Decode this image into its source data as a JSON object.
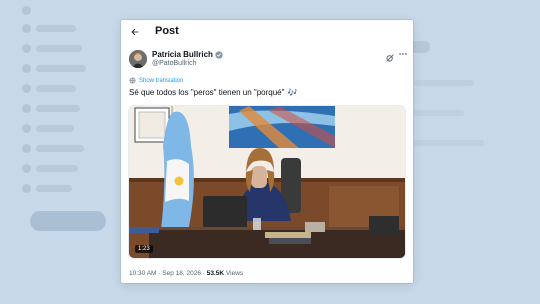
{
  "header": {
    "title": "Post"
  },
  "author": {
    "name": "Patricia Bullrich",
    "handle": "@PatoBullrich"
  },
  "translate": {
    "label": "Show translation"
  },
  "tweet": {
    "text": "Sé que todos los \"peros\" tienen un \"porqué\"",
    "emoji": "🎶"
  },
  "media": {
    "duration": "1:23"
  },
  "meta": {
    "time": "10:30 AM",
    "sep": "·",
    "date": "Sep 18, 2026",
    "views_count": "53.5K",
    "views_label": "Views"
  },
  "colors": {
    "accent": "#1d9bf0",
    "text": "#0f1419",
    "muted": "#536471"
  },
  "icons": {
    "back": "arrow-left-icon",
    "verified": "verified-badge-icon",
    "grok": "grok-icon",
    "more": "more-horizontal-icon",
    "translate": "globe-icon"
  }
}
